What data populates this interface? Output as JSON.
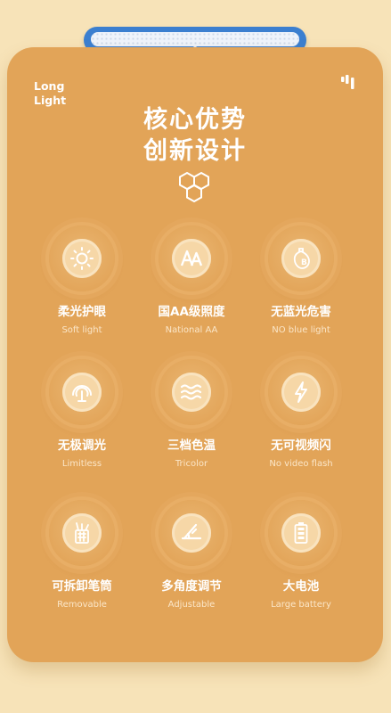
{
  "brand": {
    "line1": "Long",
    "line2": "Light"
  },
  "heading": {
    "line1": "核心优势",
    "line2": "创新设计"
  },
  "colors": {
    "card": "#e2a458",
    "background": "#f7e3b8",
    "lamp": "#3b7fd0",
    "disc": "#f6d7a7"
  },
  "features": [
    {
      "icon": "sun-icon",
      "name": "柔光护眼",
      "sub": "Soft light"
    },
    {
      "icon": "aa-icon",
      "name": "国AA级照度",
      "sub": "National AA"
    },
    {
      "icon": "bulb-b-icon",
      "name": "无蓝光危害",
      "sub": "NO blue light"
    },
    {
      "icon": "dial-icon",
      "name": "无极调光",
      "sub": "Limitless"
    },
    {
      "icon": "waves-icon",
      "name": "三档色温",
      "sub": "Tricolor"
    },
    {
      "icon": "lightning-icon",
      "name": "无可视频闪",
      "sub": "No video flash"
    },
    {
      "icon": "pen-holder-icon",
      "name": "可拆卸笔筒",
      "sub": "Removable"
    },
    {
      "icon": "angle-icon",
      "name": "多角度调节",
      "sub": "Adjustable"
    },
    {
      "icon": "battery-icon",
      "name": "大电池",
      "sub": "Large battery"
    }
  ]
}
